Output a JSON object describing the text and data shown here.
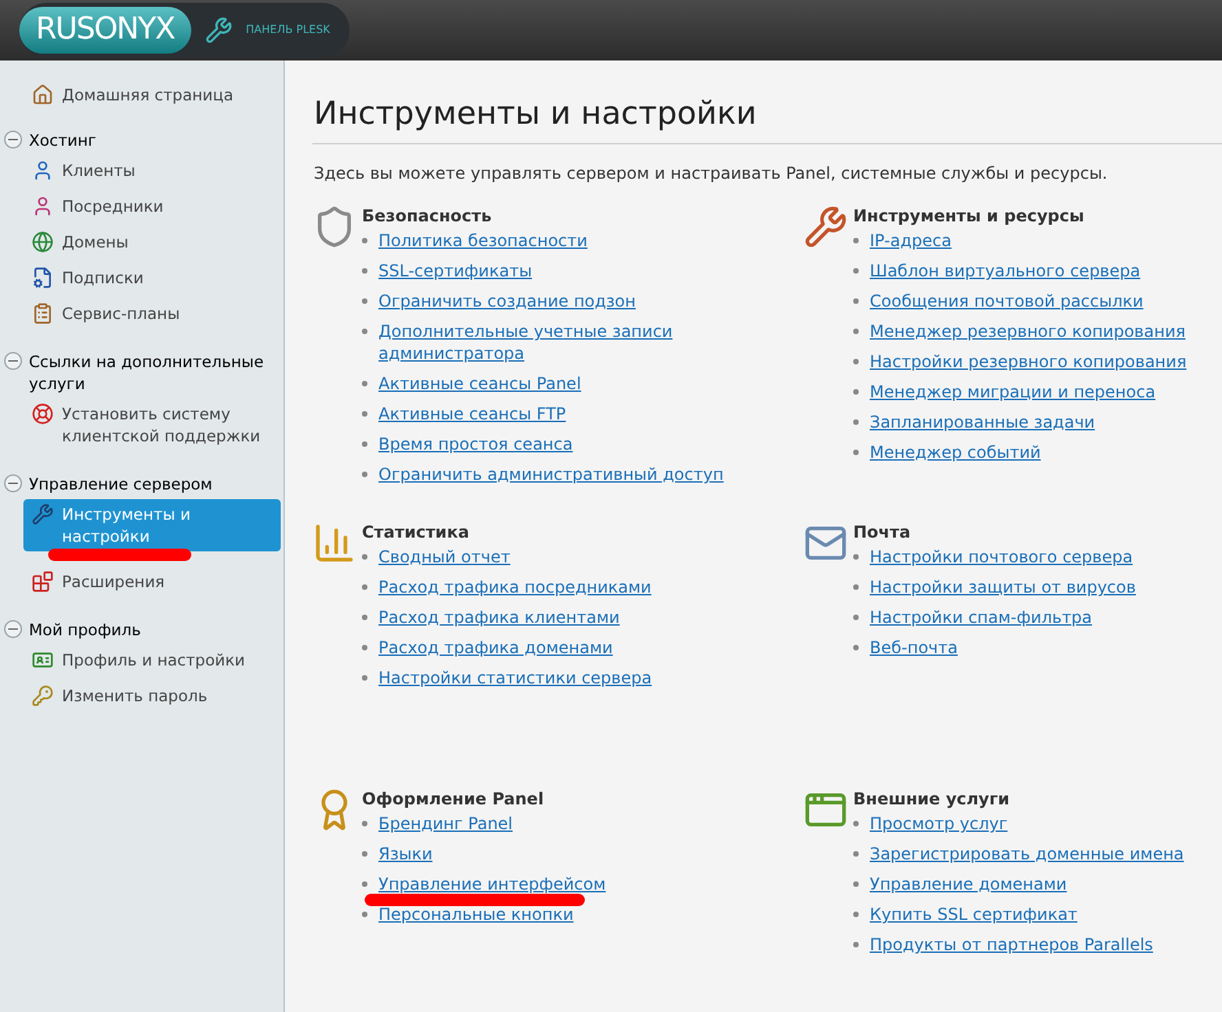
{
  "header": {
    "logo": "RUSONYX",
    "panel_label": "ПАНЕЛЬ PLESK"
  },
  "sidebar": {
    "home": {
      "label": "Домашняя страница",
      "selected": false,
      "marked": false
    },
    "groups": [
      {
        "title": "Хостинг",
        "expanded": true,
        "items": [
          {
            "label": "Клиенты",
            "selected": false,
            "marked": false
          },
          {
            "label": "Посредники",
            "selected": false,
            "marked": false
          },
          {
            "label": "Домены",
            "selected": false,
            "marked": false
          },
          {
            "label": "Подписки",
            "selected": false,
            "marked": false
          },
          {
            "label": "Сервис-планы",
            "selected": false,
            "marked": false
          }
        ]
      },
      {
        "title": "Ссылки на дополнительные услуги",
        "expanded": true,
        "items": [
          {
            "label": "Установить систему клиентской поддержки",
            "selected": false,
            "marked": false
          }
        ]
      },
      {
        "title": "Управление сервером",
        "expanded": true,
        "items": [
          {
            "label": "Инструменты и настройки",
            "selected": true,
            "marked": true
          },
          {
            "label": "Расширения",
            "selected": false,
            "marked": false
          }
        ]
      },
      {
        "title": "Мой профиль",
        "expanded": true,
        "items": [
          {
            "label": "Профиль и настройки",
            "selected": false,
            "marked": false
          },
          {
            "label": "Изменить пароль",
            "selected": false,
            "marked": false
          }
        ]
      }
    ]
  },
  "main": {
    "title": "Инструменты и настройки",
    "description": "Здесь вы можете управлять сервером и настраивать Panel, системные службы и ресурсы.",
    "sections": [
      {
        "title": "Безопасность",
        "links": [
          {
            "label": "Политика безопасности",
            "marked": false
          },
          {
            "label": "SSL-сертификаты",
            "marked": false
          },
          {
            "label": "Ограничить создание подзон",
            "marked": false
          },
          {
            "label": "Дополнительные учетные записи администратора",
            "marked": false
          },
          {
            "label": "Активные сеансы Panel",
            "marked": false
          },
          {
            "label": "Активные сеансы FTP",
            "marked": false
          },
          {
            "label": "Время простоя сеанса",
            "marked": false
          },
          {
            "label": "Ограничить административный доступ",
            "marked": false
          }
        ]
      },
      {
        "title": "Инструменты и ресурсы",
        "links": [
          {
            "label": "IP-адреса",
            "marked": false
          },
          {
            "label": "Шаблон виртуального сервера",
            "marked": false
          },
          {
            "label": "Сообщения почтовой рассылки",
            "marked": false
          },
          {
            "label": "Менеджер резервного копирования",
            "marked": false
          },
          {
            "label": "Настройки резервного копирования",
            "marked": false
          },
          {
            "label": "Менеджер миграции и переноса",
            "marked": false
          },
          {
            "label": "Запланированные задачи",
            "marked": false
          },
          {
            "label": "Менеджер событий",
            "marked": false
          }
        ]
      },
      {
        "title": "Статистика",
        "links": [
          {
            "label": "Сводный отчет",
            "marked": false
          },
          {
            "label": "Расход трафика посредниками",
            "marked": false
          },
          {
            "label": "Расход трафика клиентами",
            "marked": false
          },
          {
            "label": "Расход трафика доменами",
            "marked": false
          },
          {
            "label": "Настройки статистики сервера",
            "marked": false
          }
        ]
      },
      {
        "title": "Почта",
        "links": [
          {
            "label": "Настройки почтового сервера",
            "marked": false
          },
          {
            "label": "Настройки защиты от вирусов",
            "marked": false
          },
          {
            "label": "Настройки спам-фильтра",
            "marked": false
          },
          {
            "label": "Веб-почта",
            "marked": false
          }
        ]
      },
      {
        "title": "Оформление Panel",
        "links": [
          {
            "label": "Брендинг Panel",
            "marked": false
          },
          {
            "label": "Языки",
            "marked": false
          },
          {
            "label": "Управление интерфейсом",
            "marked": true
          },
          {
            "label": "Персональные кнопки",
            "marked": false
          }
        ]
      },
      {
        "title": "Внешние услуги",
        "links": [
          {
            "label": "Просмотр услуг",
            "marked": false
          },
          {
            "label": "Зарегистрировать доменные имена",
            "marked": false
          },
          {
            "label": "Управление доменами",
            "marked": false
          },
          {
            "label": "Купить SSL сертификат",
            "marked": false
          },
          {
            "label": "Продукты от партнеров Parallels",
            "marked": false
          }
        ]
      }
    ]
  }
}
